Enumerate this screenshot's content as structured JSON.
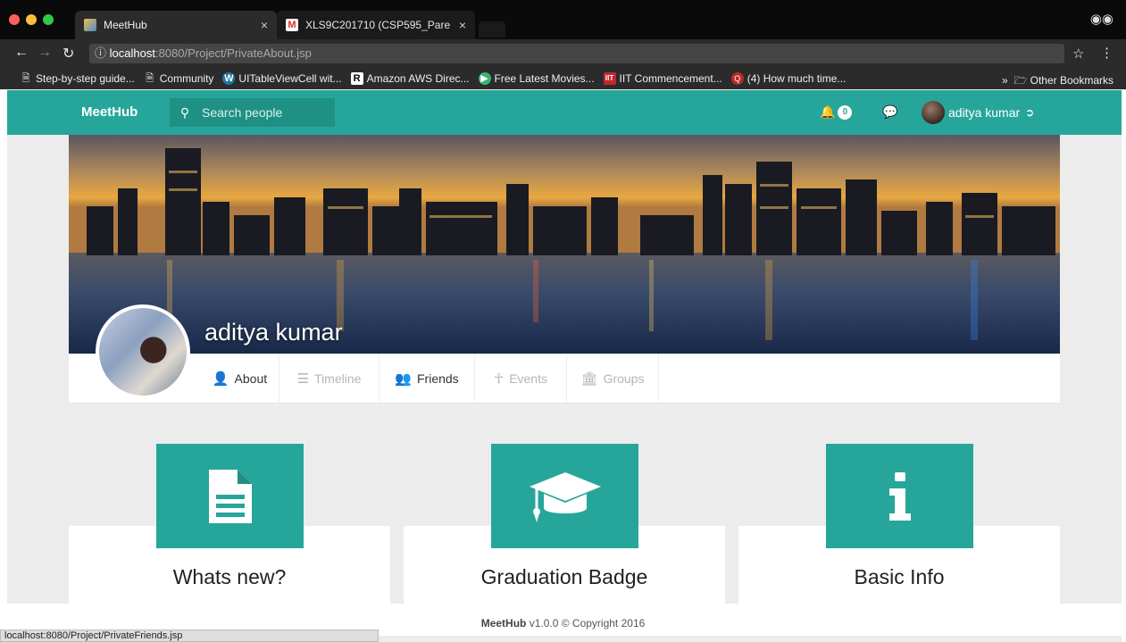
{
  "browser": {
    "tabs": [
      {
        "title": "MeetHub",
        "active": true
      },
      {
        "title": "XLS9C201710 (CSP595_Pare",
        "active": false
      }
    ],
    "url_host": "localhost",
    "url_path": ":8080/Project/PrivateAbout.jsp",
    "bookmarks": [
      {
        "label": "Step-by-step guide...",
        "icon": "page-icon"
      },
      {
        "label": "Community",
        "icon": "page-icon"
      },
      {
        "label": "UITableViewCell wit...",
        "icon": "wordpress-icon"
      },
      {
        "label": "Amazon AWS Direc...",
        "icon": "r-icon"
      },
      {
        "label": "Free Latest Movies...",
        "icon": "play-icon"
      },
      {
        "label": "IIT Commencement...",
        "icon": "iit-icon"
      },
      {
        "label": "(4) How much time...",
        "icon": "quora-icon"
      }
    ],
    "other_bookmarks": "Other Bookmarks",
    "chevron": "»",
    "status_url": "localhost:8080/Project/PrivateFriends.jsp"
  },
  "nav": {
    "brand": "MeetHub",
    "search_placeholder": "Search people",
    "notification_count": "0",
    "user_name": "aditya kumar"
  },
  "profile": {
    "name": "aditya kumar",
    "tabs": [
      {
        "label": "About",
        "active": true
      },
      {
        "label": "Timeline",
        "active": false
      },
      {
        "label": "Friends",
        "active": true
      },
      {
        "label": "Events",
        "active": false
      },
      {
        "label": "Groups",
        "active": false
      }
    ]
  },
  "cards": [
    {
      "title": "Whats new?",
      "icon": "document-icon"
    },
    {
      "title": "Graduation Badge",
      "icon": "graduation-cap-icon"
    },
    {
      "title": "Basic Info",
      "icon": "info-icon"
    }
  ],
  "footer": {
    "brand": "MeetHub",
    "text": " v1.0.0 © Copyright 2016"
  },
  "colors": {
    "accent": "#26a69a",
    "accent_dark": "#1f9084"
  }
}
